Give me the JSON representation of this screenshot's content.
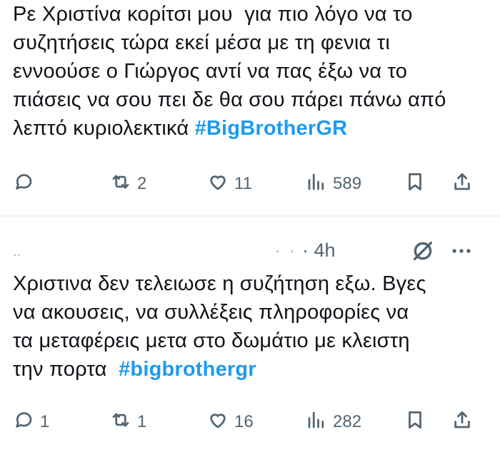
{
  "tweets": [
    {
      "text": "Ρε Χριστίνα κορίτσι μου  για πιο λόγο να το\nσυζητήσεις τώρα εκεί μέσα με τη φενια τι\nεννοούσε ο Γιώργος αντί να πας έξω να το\nπιάσεις να σου πει δε θα σου πάρει πάνω από\nλεπτό κυριολεκτικά ",
      "hashtag": "#BigBrotherGR",
      "actions": {
        "reply": "",
        "retweet": "2",
        "like": "11",
        "views": "589"
      },
      "icons": [
        "reply-icon",
        "retweet-icon",
        "like-icon",
        "views-icon",
        "bookmark-icon",
        "share-icon"
      ]
    },
    {
      "author": "..",
      "timestamp_blur": "· ·",
      "timestamp": "· 4h",
      "text": "Χριστινα δεν τελειωσε η συζήτηση εξω. Βγες\nνα ακουσεις, να συλλέξεις πληροφορίες να\nτα μεταφέρεις μετα στο δωμάτιο με κλειστη\nτην πορτα  ",
      "hashtag": "#bigbrothergr",
      "actions": {
        "reply": "1",
        "retweet": "1",
        "like": "16",
        "views": "282"
      },
      "header_icons": [
        "grok-icon",
        "more-icon"
      ],
      "icons": [
        "reply-icon",
        "retweet-icon",
        "like-icon",
        "views-icon",
        "bookmark-icon",
        "share-icon"
      ]
    }
  ],
  "colors": {
    "text": "#0f1419",
    "muted": "#536471",
    "hashtag": "#1d9bf0",
    "divider": "#eff3f4"
  }
}
